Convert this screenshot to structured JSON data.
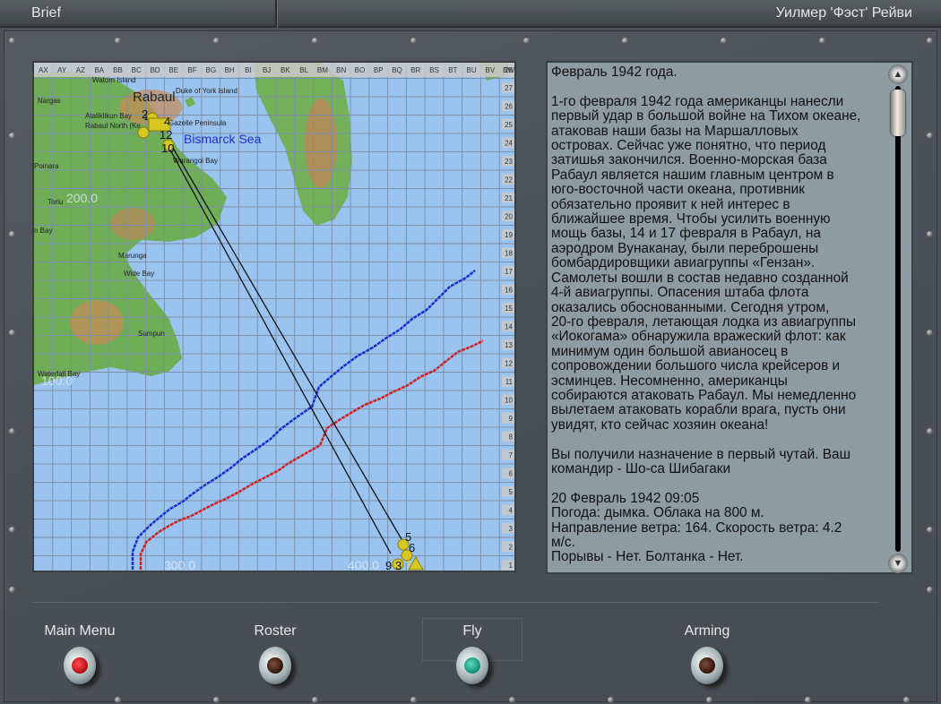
{
  "header": {
    "title": "Brief",
    "pilot_name": "Уилмер 'Фэст' Рейви"
  },
  "map": {
    "column_labels": [
      "AX",
      "AY",
      "AZ",
      "BA",
      "BB",
      "BC",
      "BD",
      "BE",
      "BF",
      "BG",
      "BH",
      "BI",
      "BJ",
      "BK",
      "BL",
      "BM",
      "BN",
      "BO",
      "BP",
      "BQ",
      "BR",
      "BS",
      "BT",
      "BU",
      "BV",
      "BW"
    ],
    "row_labels": [
      "28",
      "27",
      "26",
      "25",
      "24",
      "23",
      "22",
      "21",
      "20",
      "19",
      "18",
      "17",
      "16",
      "15",
      "14",
      "13",
      "12",
      "11",
      "10",
      "9",
      "8",
      "7",
      "6",
      "5",
      "4",
      "3",
      "2",
      "1"
    ],
    "place_names": {
      "watom": "Watom Island",
      "duke": "Duke of York Island",
      "nargas": "Nargas",
      "rabaul": "Rabaul",
      "ataliklikun": "Ataliklikun Bay",
      "rabaul_north": "Rabaul North (Ke",
      "peninsula": "Gazelle Peninsula",
      "bismarck": "Bismarck Sea",
      "warangoi": "Warangoi Bay",
      "poinara": "Poinara",
      "toriu": "Toriu",
      "bay": "n Bay",
      "marunga": "Marunga",
      "wide_bay": "Wide Bay",
      "sumpun": "Sumpun",
      "waterfall": "Waterfall Bay"
    },
    "grid_values": {
      "v200": "200.0",
      "v100": "100.0",
      "v300": "300.0",
      "v400": "400.0"
    },
    "waypoint_numbers": {
      "a": "2",
      "b": "4",
      "c": "12",
      "d": "10",
      "e": "1",
      "f": "5",
      "g": "6",
      "h": "9",
      "i": "3",
      "j": "7"
    },
    "colors": {
      "sea": "#9ac3ef",
      "friendly_route": "#1a2fd0",
      "enemy_route": "#d02020",
      "marker": "#d6c820"
    }
  },
  "brief": {
    "lines": [
      "Февраль 1942 года.",
      "",
      "1-го февраля 1942 года американцы нанесли",
      "первый удар в большой войне на Тихом океане,",
      "атаковав наши базы на Маршалловых",
      "островах. Сейчас уже понятно, что период",
      "затишья закончился. Военно-морская база",
      "Рабаул является нашим главным центром в",
      "юго-восточной части океана, противник",
      "обязательно проявит к ней интерес в",
      "ближайшее время. Чтобы усилить военную",
      "мощь базы, 14 и 17 февраля в Рабаул, на",
      "аэродром Вунаканау, были переброшены",
      "бомбардировщики авиагруппы «Гензан».",
      "Самолеты вошли в состав недавно созданной",
      "4-й авиагруппы. Опасения штаба флота",
      "оказались обоснованными. Сегодня утром,",
      "20-го февраля, летающая лодка из авиагруппы",
      "«Иокогама» обнаружила вражеский флот: как",
      "минимум один большой авианосец в",
      "сопровождении большого числа крейсеров и",
      "эсминцев. Несомненно, американцы",
      "собираются атаковать Рабаул. Мы немедленно",
      "вылетаем атаковать корабли врага, пусть они",
      "увидят, кто сейчас хозяин океана!",
      "",
      "Вы получили назначение в первый чутай. Ваш",
      "командир - Шо-са Шибагаки",
      "",
      "20 Февраль 1942 09:05",
      "Погода: дымка. Облака на 800 м.",
      "Направление ветра: 164. Скорость ветра: 4.2",
      "м/с.",
      "Порывы - Нет. Болтанка - Нет."
    ]
  },
  "buttons": {
    "main_menu": "Main Menu",
    "roster": "Roster",
    "fly": "Fly",
    "arming": "Arming"
  },
  "button_colors": {
    "main_menu": "#c0141c",
    "roster": "#3a1a10",
    "fly": "#1a9a80",
    "arming": "#3a1a10"
  }
}
